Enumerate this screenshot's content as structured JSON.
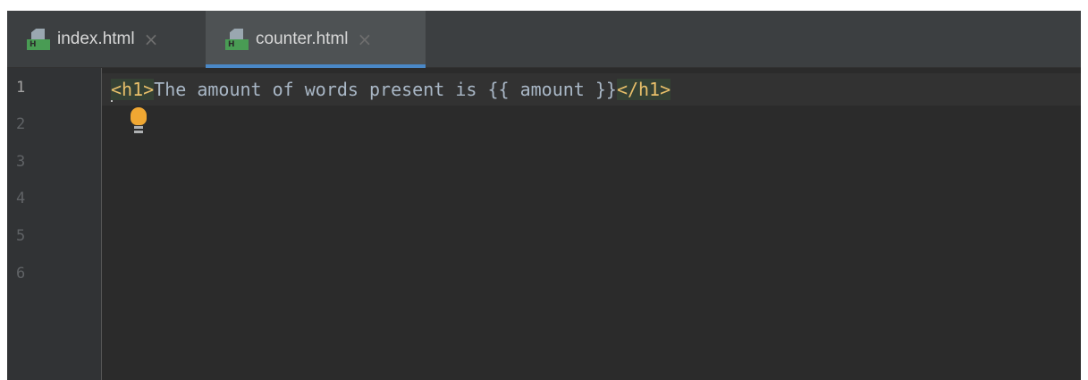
{
  "tabs": [
    {
      "label": "index.html",
      "icon": "html-file-icon",
      "icon_badge": "H",
      "active": false
    },
    {
      "label": "counter.html",
      "icon": "html-file-icon",
      "icon_badge": "H",
      "active": true
    }
  ],
  "tab_close_glyph": "×",
  "editor": {
    "line_numbers": [
      "1",
      "2",
      "3",
      "4",
      "5",
      "6"
    ],
    "current_line": 1,
    "code_line_1": {
      "open_tag": "<h1>",
      "text": "The amount of words present is {{ amount }}",
      "close_tag": "</h1>"
    },
    "intention_icon": "lightbulb-icon"
  },
  "colors": {
    "background": "#2b2b2b",
    "gutter": "#313335",
    "tag": "#e8bf6a",
    "text": "#a9b7c6",
    "active_tab_underline": "#4a88c7",
    "html_icon_badge": "#499c54",
    "lightbulb": "#f0a732"
  }
}
